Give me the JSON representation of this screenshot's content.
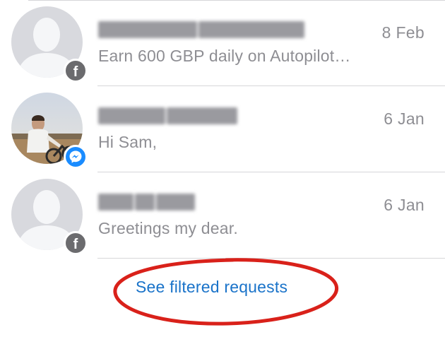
{
  "conversations": [
    {
      "date": "8 Feb",
      "preview": "Earn 600 GBP daily on Autopilot…",
      "badge_icon": "facebook-icon",
      "avatar": "default-silhouette"
    },
    {
      "date": "6 Jan",
      "preview": "Hi Sam,",
      "badge_icon": "messenger-icon",
      "avatar": "photo"
    },
    {
      "date": "6 Jan",
      "preview": "Greetings my dear.",
      "badge_icon": "facebook-icon",
      "avatar": "default-silhouette"
    }
  ],
  "see_filtered_label": "See filtered requests",
  "colors": {
    "link": "#1a73c9",
    "secondary_text": "#8e8e93",
    "annotation": "#d9211a",
    "messenger": "#1a8cff"
  }
}
